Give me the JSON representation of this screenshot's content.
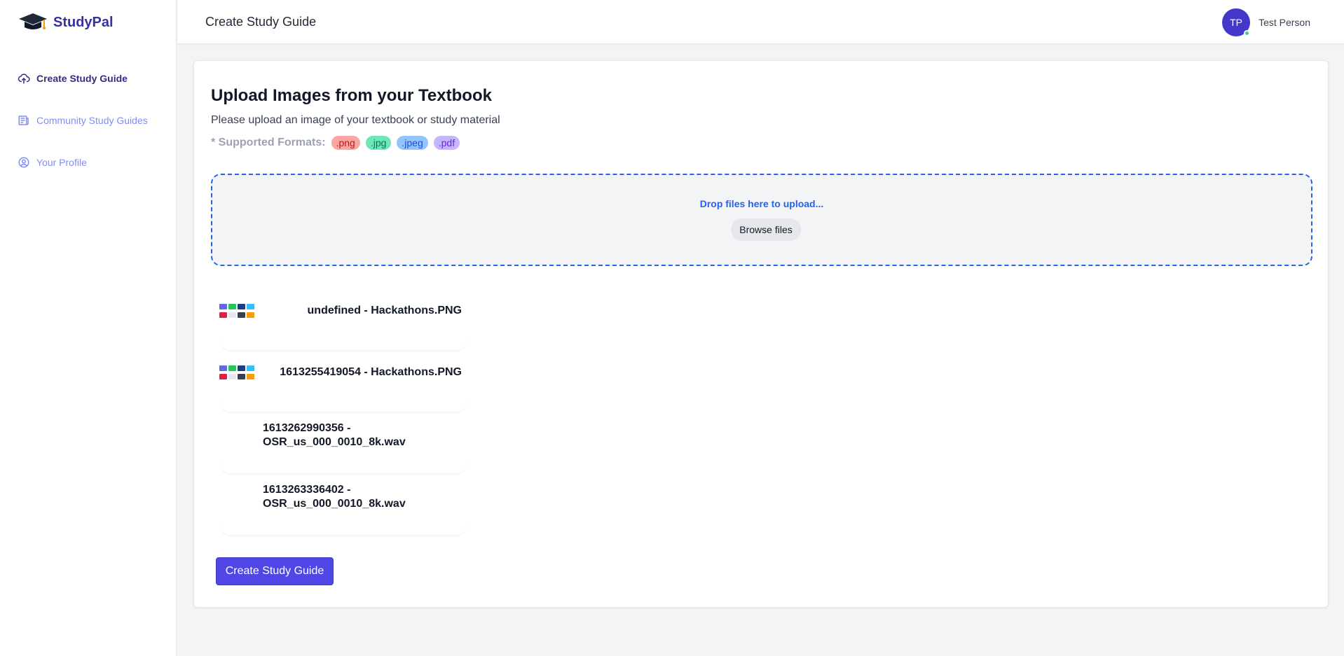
{
  "app": {
    "name": "StudyPal"
  },
  "sidebar": {
    "items": [
      {
        "label": "Create Study Guide",
        "icon": "upload-cloud-icon",
        "active": true
      },
      {
        "label": "Community Study Guides",
        "icon": "newspaper-icon",
        "active": false
      },
      {
        "label": "Your Profile",
        "icon": "user-circle-icon",
        "active": false
      }
    ]
  },
  "header": {
    "title": "Create Study Guide",
    "user": {
      "initials": "TP",
      "name": "Test Person",
      "status_color": "#34d399"
    }
  },
  "main": {
    "heading": "Upload Images from your Textbook",
    "subheading": "Please upload an image of your textbook or study material",
    "formats_label": "* Supported Formats:",
    "formats": [
      ".png",
      ".jpg",
      ".jpeg",
      ".pdf"
    ],
    "dropzone": {
      "hint": "Drop files here to upload...",
      "browse_label": "Browse files"
    },
    "files": [
      {
        "name": "undefined - Hackathons.PNG",
        "thumbnail": true
      },
      {
        "name": "1613255419054 - Hackathons.PNG",
        "thumbnail": true
      },
      {
        "name": "1613262990356 - OSR_us_000_0010_8k.wav",
        "thumbnail": false
      },
      {
        "name": "1613263336402 - OSR_us_000_0010_8k.wav",
        "thumbnail": false
      }
    ],
    "submit_label": "Create Study Guide"
  },
  "colors": {
    "accent": "#4f46e5",
    "brand": "#3730a3",
    "dropzone_border": "#2563eb"
  }
}
